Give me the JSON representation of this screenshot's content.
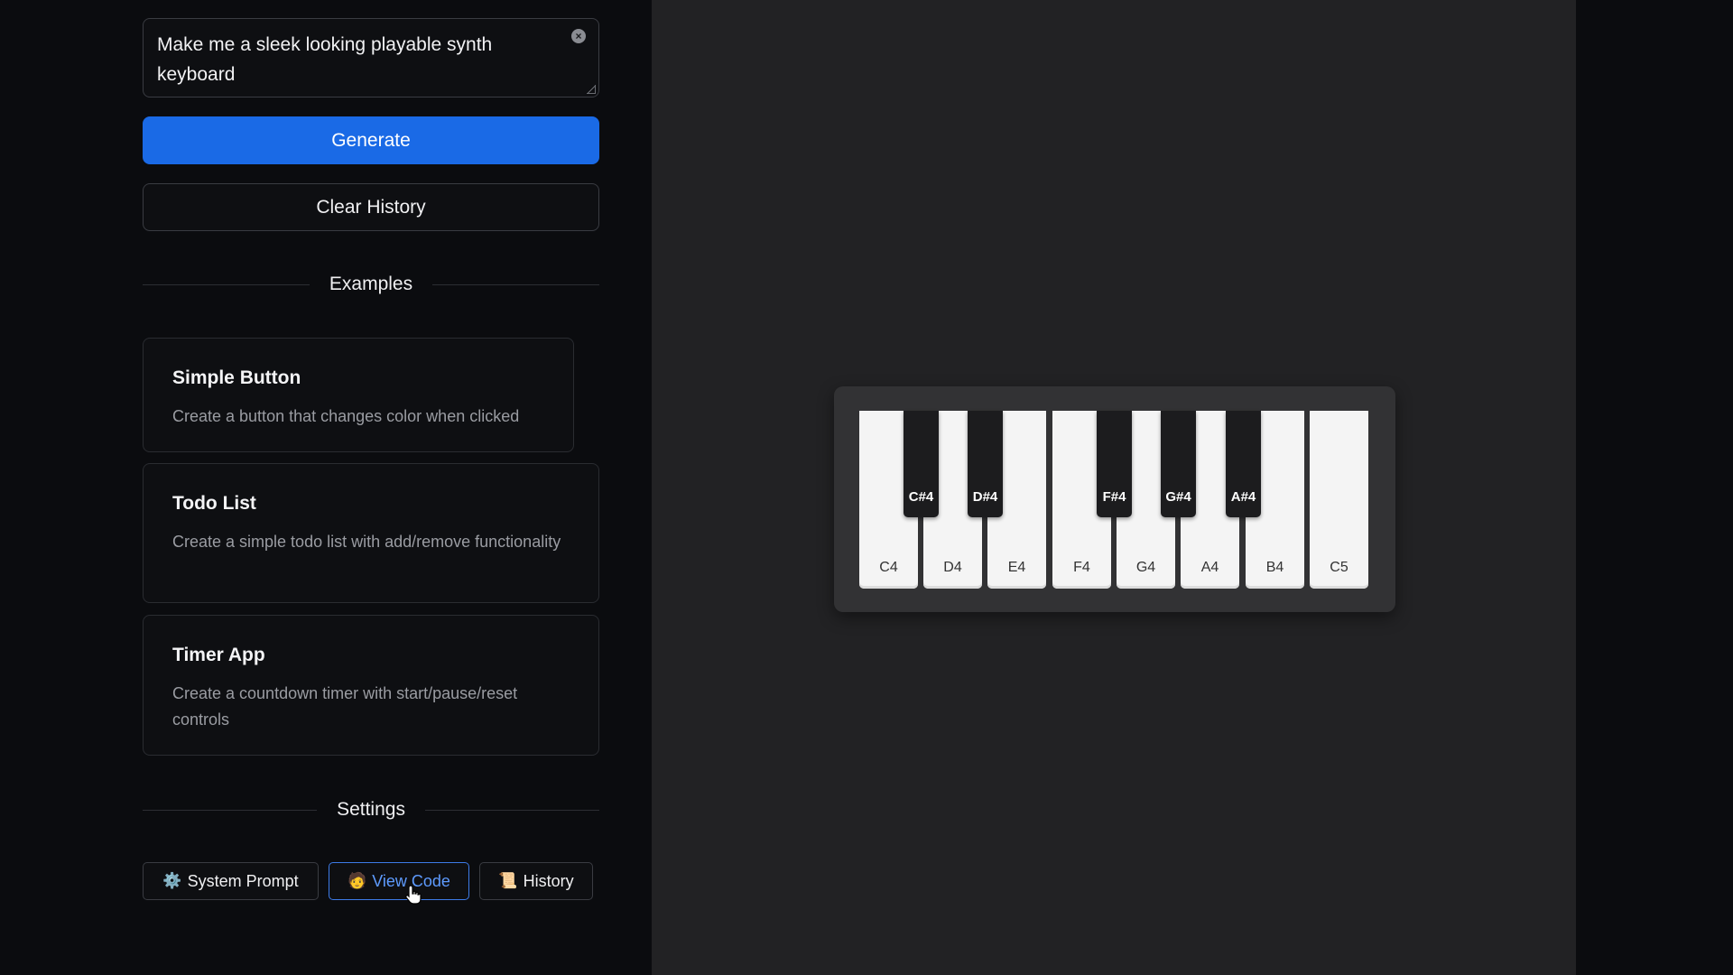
{
  "prompt": {
    "value": "Make me a sleek looking playable synth keyboard"
  },
  "buttons": {
    "generate": "Generate",
    "clear_history": "Clear History"
  },
  "examples": {
    "heading": "Examples",
    "items": [
      {
        "title": "Simple Button",
        "description": "Create a button that changes color when clicked"
      },
      {
        "title": "Todo List",
        "description": "Create a simple todo list with add/remove functionality"
      },
      {
        "title": "Timer App",
        "description": "Create a countdown timer with start/pause/reset controls"
      }
    ]
  },
  "settings": {
    "heading": "Settings",
    "system_prompt": {
      "icon": "⚙️",
      "label": "System Prompt"
    },
    "view_code": {
      "icon": "🧑",
      "label": "View Code"
    },
    "history": {
      "icon": "📜",
      "label": "History"
    }
  },
  "keyboard": {
    "white_keys": [
      "C4",
      "D4",
      "E4",
      "F4",
      "G4",
      "A4",
      "B4",
      "C5"
    ],
    "black_keys": [
      "C#4",
      "D#4",
      "F#4",
      "G#4",
      "A#4"
    ]
  },
  "colors": {
    "accent": "#1a6ae6",
    "active_outline": "#3d7be8",
    "preview_bg": "#222224"
  }
}
